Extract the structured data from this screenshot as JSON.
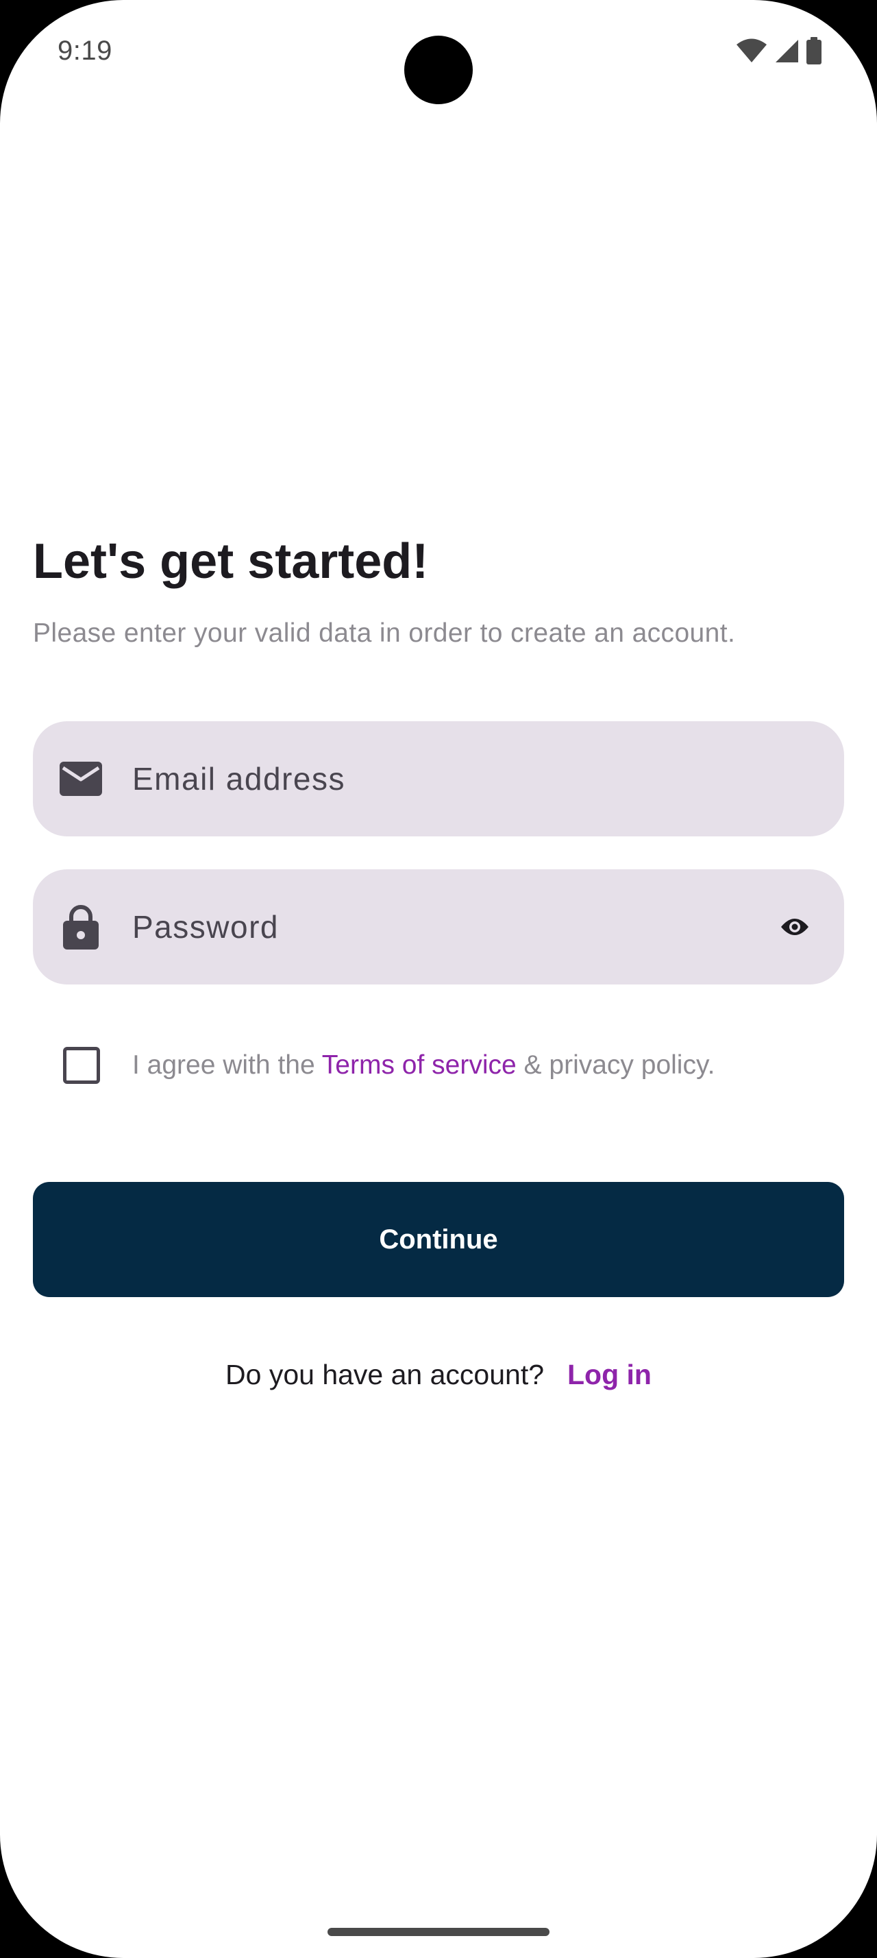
{
  "status_bar": {
    "time": "9:19",
    "icons": [
      "wifi-icon",
      "cellular-signal-icon",
      "battery-icon"
    ]
  },
  "header": {
    "title": "Let's get started!",
    "subtitle": "Please enter your valid data in order to create an account."
  },
  "form": {
    "email": {
      "icon": "mail-icon",
      "placeholder": "Email address",
      "value": ""
    },
    "password": {
      "icon": "lock-icon",
      "placeholder": "Password",
      "value": "",
      "toggle_icon": "eye-icon"
    },
    "agreement": {
      "checked": false,
      "prefix": "I agree with the ",
      "terms_link": "Terms of service",
      "suffix": " & privacy policy."
    },
    "continue_label": "Continue"
  },
  "footer": {
    "question": "Do you have an account?",
    "login_link": "Log in"
  },
  "colors": {
    "accent": "#8e24aa",
    "primary_button": "#052a44",
    "field_background": "#e6e0e9",
    "muted_text": "#8c8a90"
  }
}
